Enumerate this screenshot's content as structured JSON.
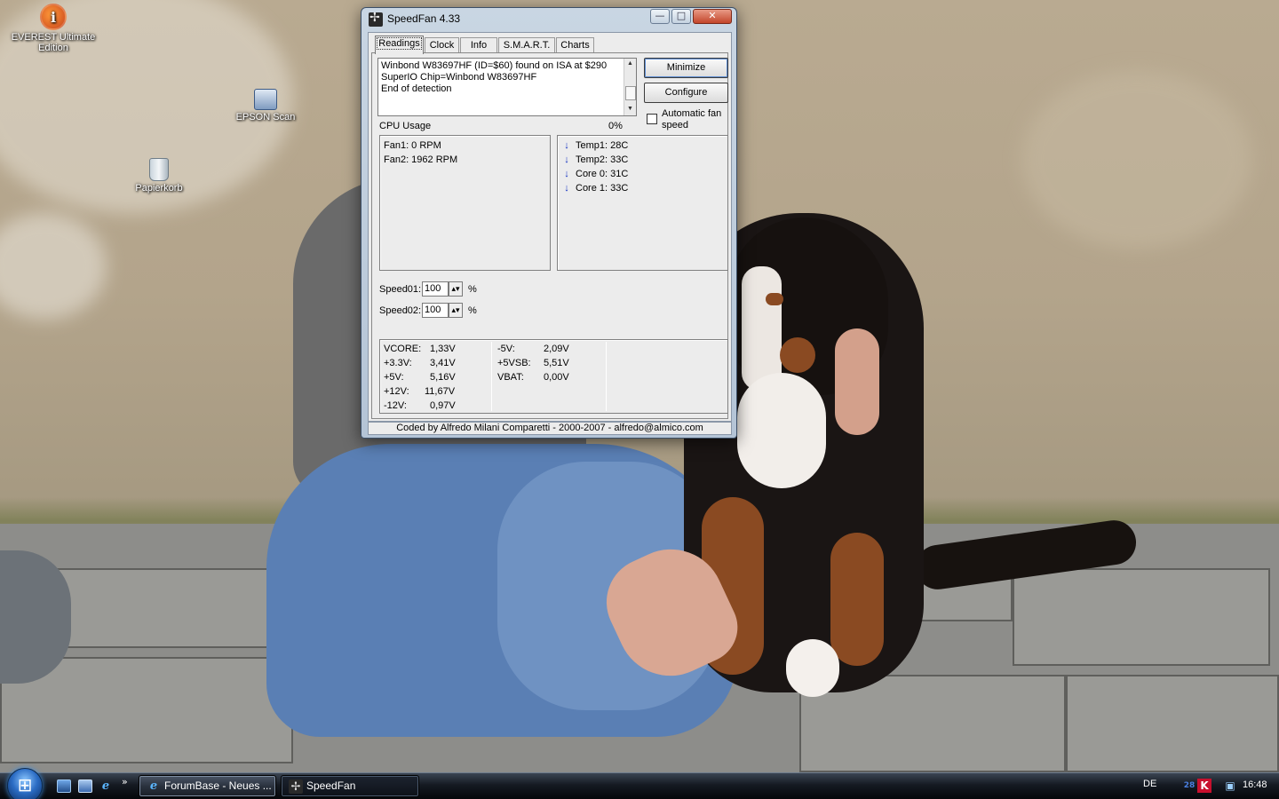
{
  "desktop": {
    "icons": [
      {
        "label": "EVEREST Ultimate Edition",
        "icon": "everest-icon"
      },
      {
        "label": "EPSON Scan",
        "icon": "scanner-icon"
      },
      {
        "label": "Papierkorb",
        "icon": "recycle-bin-icon"
      }
    ]
  },
  "window": {
    "title": "SpeedFan 4.33",
    "caption_buttons": {
      "minimize": "—",
      "maximize": "□",
      "close": "✕"
    }
  },
  "tabs": [
    {
      "label": "Readings",
      "active": true
    },
    {
      "label": "Clock",
      "active": false
    },
    {
      "label": "Info",
      "active": false
    },
    {
      "label": "S.M.A.R.T.",
      "active": false
    },
    {
      "label": "Charts",
      "active": false
    }
  ],
  "log": {
    "lines": [
      "Winbond W83697HF (ID=$60) found on ISA at $290",
      "SuperIO Chip=Winbond W83697HF",
      "End of detection"
    ]
  },
  "buttons": {
    "minimize": "Minimize",
    "configure": "Configure"
  },
  "auto_fan": {
    "label": "Automatic fan speed",
    "checked": false
  },
  "cpu": {
    "label": "CPU Usage",
    "value": "0%"
  },
  "fans": [
    "Fan1: 0 RPM",
    "Fan2: 1962 RPM"
  ],
  "temps": [
    {
      "label": "Temp1: 28C",
      "trend": "down"
    },
    {
      "label": "Temp2: 33C",
      "trend": "down"
    },
    {
      "label": "Core 0:  31C",
      "trend": "down"
    },
    {
      "label": "Core 1:  33C",
      "trend": "down"
    }
  ],
  "speeds": [
    {
      "label": "Speed01:",
      "value": "100",
      "unit": "%"
    },
    {
      "label": "Speed02:",
      "value": "100",
      "unit": "%"
    }
  ],
  "voltages": {
    "col1": [
      {
        "label": "VCORE:",
        "value": "1,33V"
      },
      {
        "label": "+3.3V:",
        "value": "3,41V"
      },
      {
        "label": "+5V:",
        "value": "5,16V"
      },
      {
        "label": "+12V:",
        "value": "11,67V"
      },
      {
        "label": "-12V:",
        "value": "0,97V"
      }
    ],
    "col2": [
      {
        "label": "-5V:",
        "value": "2,09V"
      },
      {
        "label": "+5VSB:",
        "value": "5,51V"
      },
      {
        "label": "VBAT:",
        "value": "0,00V"
      }
    ]
  },
  "status": "Coded by Alfredo Milani Comparetti - 2000-2007 - alfredo@almico.com",
  "taskbar": {
    "quick_launch_more": "»",
    "tasks": [
      {
        "label": "ForumBase - Neues ...",
        "icon": "ie-icon",
        "active": false
      },
      {
        "label": "SpeedFan",
        "icon": "speedfan-icon",
        "active": true
      }
    ],
    "language": "DE",
    "clock": "16:48"
  }
}
